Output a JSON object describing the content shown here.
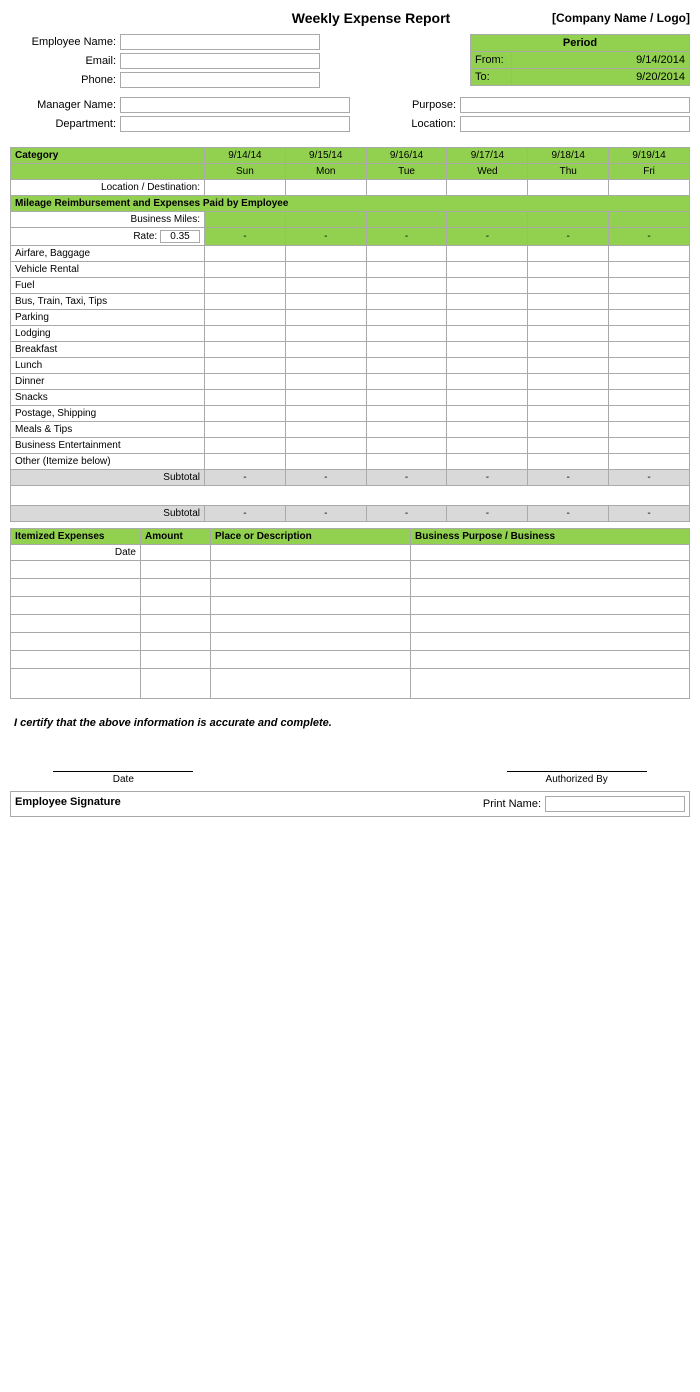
{
  "header": {
    "title": "Weekly Expense Report",
    "company": "[Company Name / Logo]"
  },
  "employee": {
    "name_label": "Employee Name:",
    "email_label": "Email:",
    "phone_label": "Phone:"
  },
  "period": {
    "label": "Period",
    "from_label": "From:",
    "from_value": "9/14/2014",
    "to_label": "To:",
    "to_value": "9/20/2014"
  },
  "manager": {
    "name_label": "Manager Name:",
    "dept_label": "Department:",
    "purpose_label": "Purpose:",
    "location_label": "Location:"
  },
  "table": {
    "category_label": "Category",
    "location_label": "Location / Destination:",
    "section_label": "Mileage Reimbursement and Expenses Paid by Employee",
    "miles_label": "Business Miles:",
    "rate_label": "Rate:",
    "rate_value": "0.35",
    "dates": [
      "9/14/14",
      "9/15/14",
      "9/16/14",
      "9/17/14",
      "9/18/14",
      "9/19/14"
    ],
    "days": [
      "Sun",
      "Mon",
      "Tue",
      "Wed",
      "Thu",
      "Fri"
    ],
    "categories": [
      "Airfare, Baggage",
      "Vehicle Rental",
      "Fuel",
      "Bus, Train, Taxi, Tips",
      "Parking",
      "Lodging",
      "Breakfast",
      "Lunch",
      "Dinner",
      "Snacks",
      "Postage, Shipping",
      "Meals & Tips",
      "Business Entertainment",
      "Other (Itemize below)"
    ],
    "subtotal_label": "Subtotal",
    "dash": "-"
  },
  "itemized": {
    "header_label": "Itemized Expenses",
    "amount_label": "Amount",
    "place_label": "Place or Description",
    "purpose_label": "Business Purpose / Business",
    "date_label": "Date",
    "rows": 7
  },
  "certify": {
    "text": "I certify that the above information is accurate and complete."
  },
  "signature": {
    "date_label": "Date",
    "authorized_label": "Authorized By",
    "employee_sig_label": "Employee Signature",
    "print_name_label": "Print Name:"
  }
}
